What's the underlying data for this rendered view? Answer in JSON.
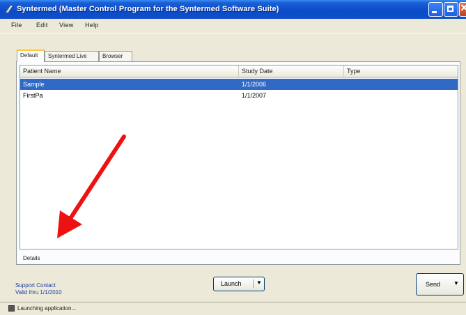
{
  "window": {
    "title": "Syntermed (Master Control Program for the Syntermed Software Suite)",
    "accent_color": "#0a4bc9"
  },
  "menu": {
    "items": [
      "File",
      "Edit",
      "View",
      "Help"
    ]
  },
  "tabs": [
    {
      "label": "Default",
      "active": true
    },
    {
      "label": "Syntermed Live",
      "active": false
    },
    {
      "label": "Browser",
      "active": false
    }
  ],
  "table": {
    "columns": [
      "Patient Name",
      "Study Date",
      "Type"
    ],
    "rows": [
      {
        "name": "Sample",
        "date": "1/1/2006",
        "type": "",
        "selected": true
      },
      {
        "name": "FirstPa",
        "date": "1/1/2007",
        "type": "",
        "selected": false
      }
    ]
  },
  "details": {
    "label": "Details"
  },
  "footer": {
    "support_line": "Support Contact",
    "version_line": "Valid thru 1/1/2010",
    "launch_label": "Launch",
    "send_label": "Send"
  },
  "status": {
    "text": "Launching application..."
  },
  "annotation": {
    "arrow_color": "#ee1111",
    "icon": "red-arrow-icon"
  }
}
